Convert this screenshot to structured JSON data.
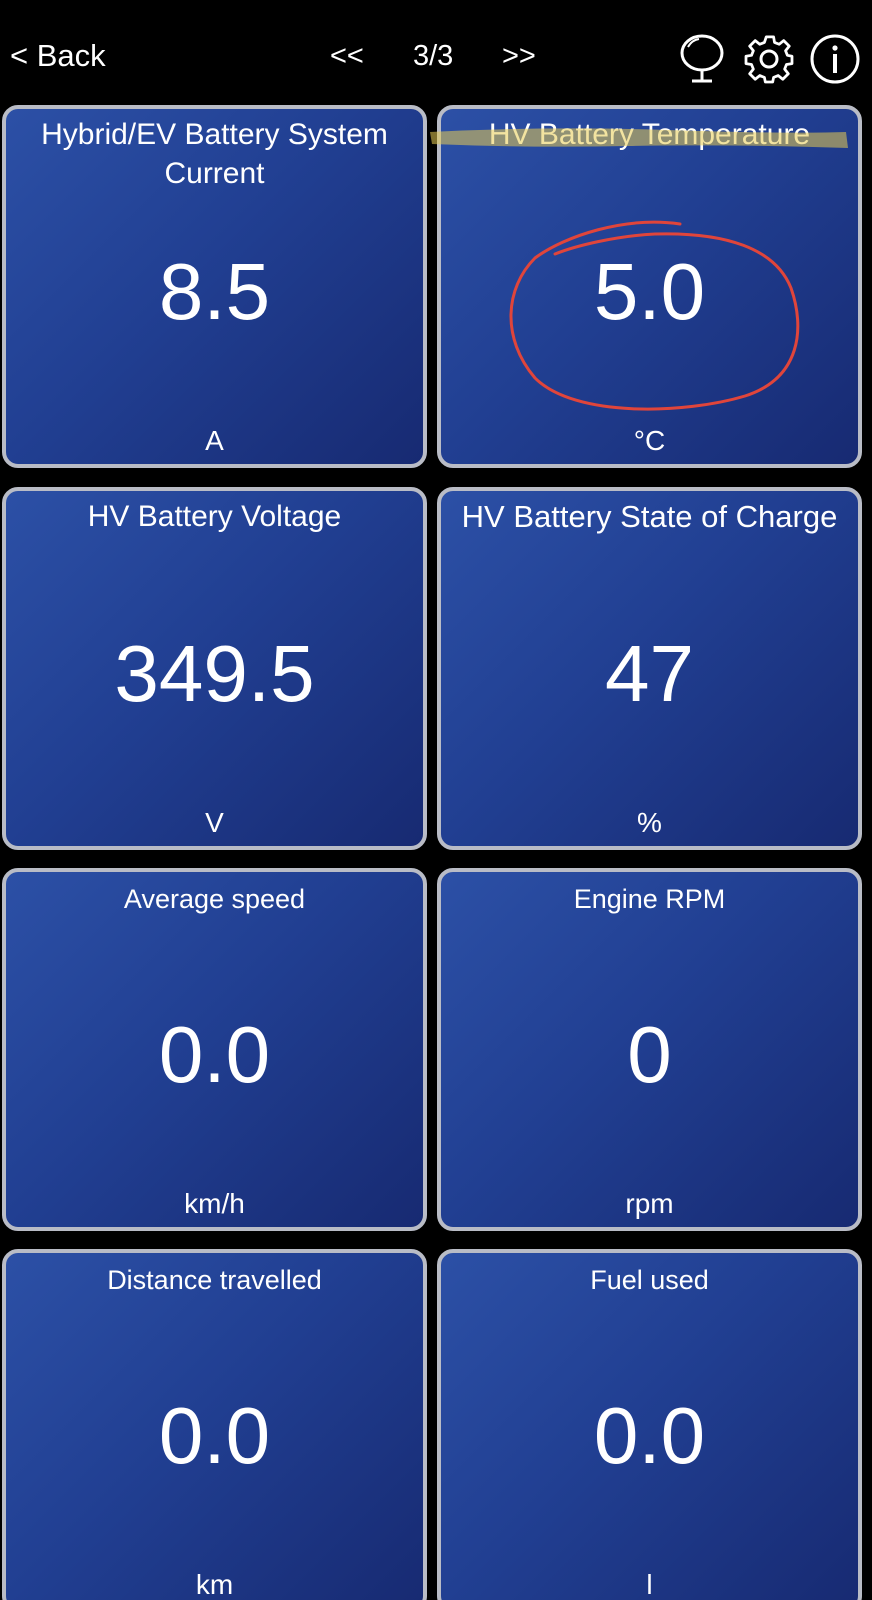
{
  "header": {
    "back_label": "< Back",
    "prev_label": "<<",
    "page_indicator": "3/3",
    "next_label": ">>",
    "icons": [
      "mirror-icon",
      "gear-icon",
      "info-icon"
    ]
  },
  "tiles": [
    {
      "title": "Hybrid/EV Battery System Current",
      "value": "8.5",
      "unit": "A"
    },
    {
      "title": "HV Battery Temperature",
      "value": "5.0",
      "unit": "°C"
    },
    {
      "title": "HV Battery Voltage",
      "value": "349.5",
      "unit": "V"
    },
    {
      "title": "HV Battery State of Charge",
      "value": "47",
      "unit": "%"
    },
    {
      "title": "Average speed",
      "value": "0.0",
      "unit": "km/h"
    },
    {
      "title": "Engine RPM",
      "value": "0",
      "unit": "rpm"
    },
    {
      "title": "Distance travelled",
      "value": "0.0",
      "unit": "km"
    },
    {
      "title": "Fuel used",
      "value": "0.0",
      "unit": "l"
    }
  ],
  "colors": {
    "background": "#000000",
    "tile_gradient_start": "#2c50a6",
    "tile_gradient_end": "#172a72",
    "tile_border": "#b9bcc6",
    "highlight": "#e8cc52",
    "circle_annotation": "#e0453b"
  }
}
